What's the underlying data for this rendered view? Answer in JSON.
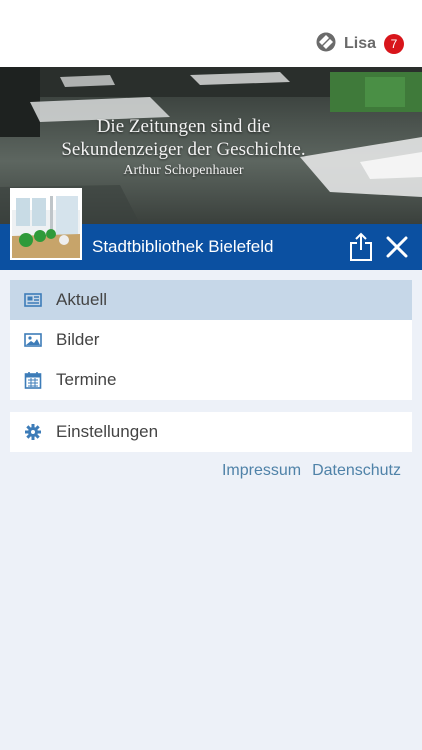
{
  "user": {
    "name": "Lisa",
    "notifications": "7"
  },
  "hero": {
    "quote_line1": "Die Zeitungen sind die",
    "quote_line2": "Sekundenzeiger der Geschichte.",
    "quote_author": "Arthur Schopenhauer"
  },
  "library": {
    "name": "Stadtbibliothek Bielefeld"
  },
  "menu": {
    "items": [
      {
        "label": "Aktuell",
        "icon": "newspaper-icon",
        "active": true
      },
      {
        "label": "Bilder",
        "icon": "image-icon",
        "active": false
      },
      {
        "label": "Termine",
        "icon": "calendar-icon",
        "active": false
      }
    ],
    "settings": {
      "label": "Einstellungen",
      "icon": "gear-icon"
    }
  },
  "footer": {
    "impressum": "Impressum",
    "datenschutz": "Datenschutz"
  },
  "colors": {
    "primary_blue": "#0b50a1",
    "active_item": "#c6d7e8",
    "background": "#edf1f8",
    "badge_red": "#d8151b",
    "link": "#4f82a8",
    "icon_blue": "#3d7cb8"
  }
}
